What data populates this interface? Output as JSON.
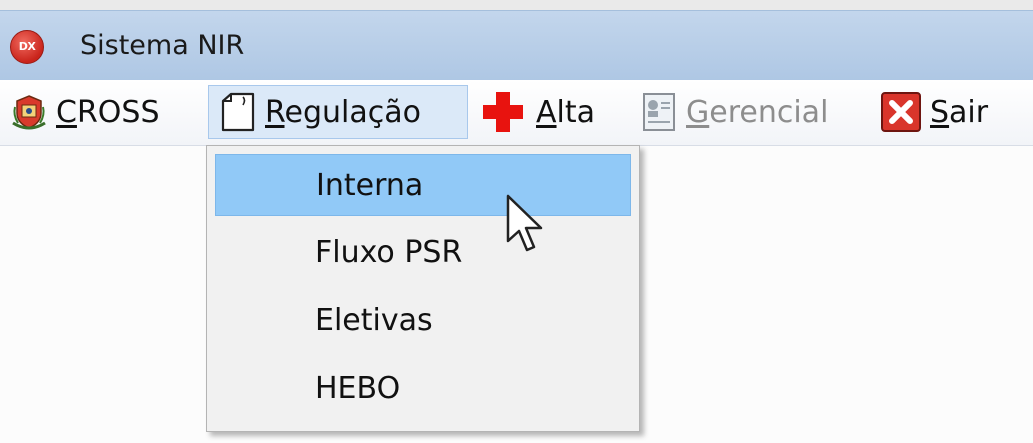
{
  "window": {
    "title": "Sistema NIR",
    "app_icon_text": "DX"
  },
  "menubar": {
    "items": [
      {
        "label_ul": "C",
        "label_rest": "ROSS",
        "icon": "state-emblem-icon",
        "enabled": true
      },
      {
        "label_ul": "R",
        "label_rest": "egulação",
        "icon": "document-icon",
        "enabled": true,
        "active": true
      },
      {
        "label_ul": "A",
        "label_rest": "lta",
        "icon": "red-cross-icon",
        "enabled": true
      },
      {
        "label_ul": "G",
        "label_rest": "erencial",
        "icon": "id-card-icon",
        "enabled": false
      },
      {
        "label_ul": "S",
        "label_rest": "air",
        "icon": "close-icon",
        "enabled": true
      }
    ]
  },
  "dropdown": {
    "items": [
      {
        "label": "Interna",
        "highlighted": true
      },
      {
        "label": "Fluxo PSR"
      },
      {
        "label": "Eletivas"
      },
      {
        "label": "HEBO"
      }
    ]
  },
  "colors": {
    "titlebar": "#b8cfe9",
    "menu_active": "#dbe9f8",
    "dropdown_bg": "#f1f1f1",
    "dropdown_highlight": "#91c9f7",
    "exit_red": "#d9352b",
    "cross_red": "#e8130f"
  }
}
